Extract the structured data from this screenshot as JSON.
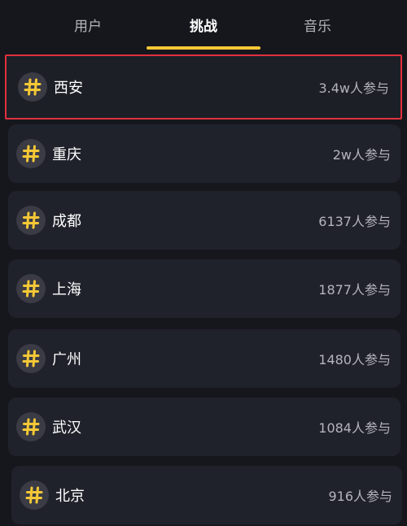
{
  "tabs": [
    {
      "label": "用户",
      "active": false
    },
    {
      "label": "挑战",
      "active": true
    },
    {
      "label": "音乐",
      "active": false
    }
  ],
  "colors": {
    "background": "#16171d",
    "card": "#20222b",
    "accent": "#f5c836",
    "selection_border": "#e0303e",
    "muted_text": "#b4b4bb"
  },
  "hash_icon": "hashtag-icon",
  "challenges": [
    {
      "city": "西安",
      "count": "3.4w人参与",
      "selected": true
    },
    {
      "city": "重庆",
      "count": "2w人参与",
      "selected": false
    },
    {
      "city": "成都",
      "count": "6137人参与",
      "selected": false
    },
    {
      "city": "上海",
      "count": "1877人参与",
      "selected": false
    },
    {
      "city": "广州",
      "count": "1480人参与",
      "selected": false
    },
    {
      "city": "武汉",
      "count": "1084人参与",
      "selected": false
    },
    {
      "city": "北京",
      "count": "916人参与",
      "selected": false
    }
  ]
}
